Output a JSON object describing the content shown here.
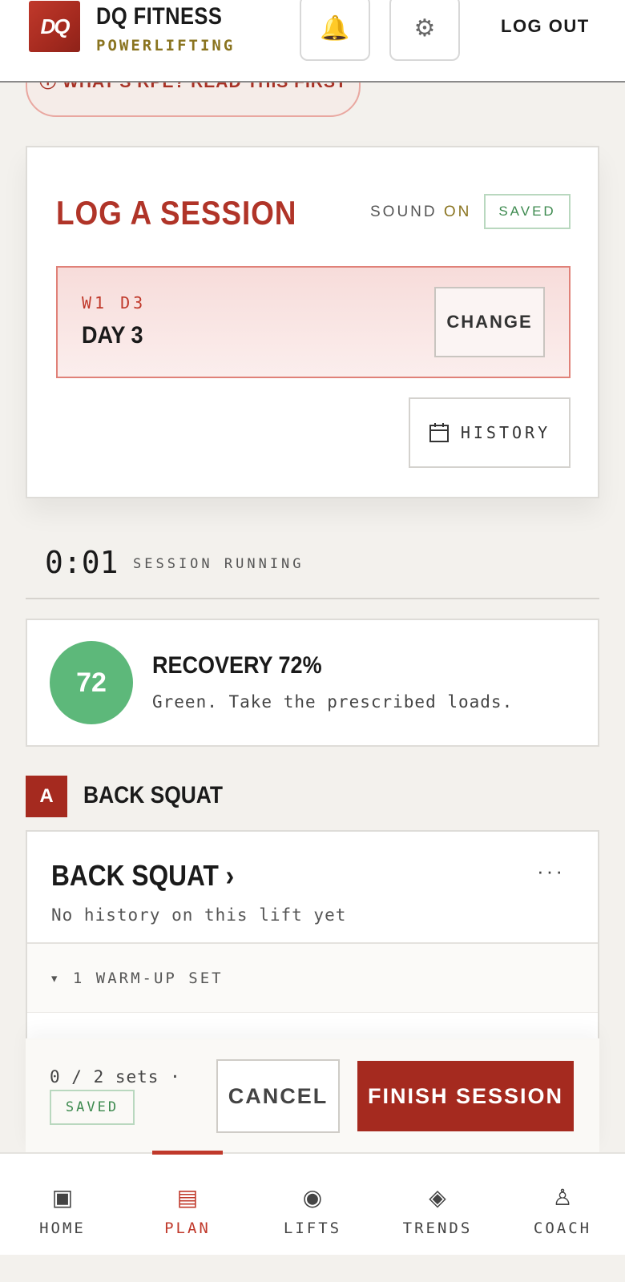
{
  "header": {
    "logo_text": "DQ",
    "brand_name": "DQ FITNESS",
    "brand_sub": "POWERLIFTING",
    "bell_icon": "🔔",
    "gear_icon": "⚙",
    "logout_label": "LOG OUT"
  },
  "rpe_banner": {
    "label": "ⓘ WHAT'S RPE? READ THIS FIRST"
  },
  "session": {
    "title": "LOG A SESSION",
    "sound_label": "SOUND",
    "sound_value": "ON",
    "saved_label": "SAVED",
    "day_code": "W1 D3",
    "day_name": "DAY 3",
    "change_label": "CHANGE",
    "history_label": "HISTORY"
  },
  "timer": {
    "value": "0:01",
    "status": "SESSION RUNNING"
  },
  "recovery": {
    "score": "72",
    "title": "RECOVERY 72%",
    "message": "Green. Take the prescribed loads."
  },
  "exercise": {
    "letter": "A",
    "heading": "BACK SQUAT",
    "title": "BACK SQUAT ›",
    "more": "···",
    "subtitle": "No history on this lift yet",
    "warmup": "▾ 1 WARM-UP SET"
  },
  "action_bar": {
    "sets_text": "0 / 2 sets ·",
    "saved_label": "SAVED",
    "cancel_label": "CANCEL",
    "finish_label": "FINISH SESSION"
  },
  "nav": {
    "items": [
      {
        "label": "HOME",
        "icon": "▣"
      },
      {
        "label": "PLAN",
        "icon": "▤"
      },
      {
        "label": "LIFTS",
        "icon": "◉"
      },
      {
        "label": "TRENDS",
        "icon": "◈"
      },
      {
        "label": "COACH",
        "icon": "♙"
      }
    ],
    "active": "PLAN"
  },
  "colors": {
    "accent": "#a52a1f",
    "green": "#5db87a",
    "gold": "#8a7420"
  }
}
